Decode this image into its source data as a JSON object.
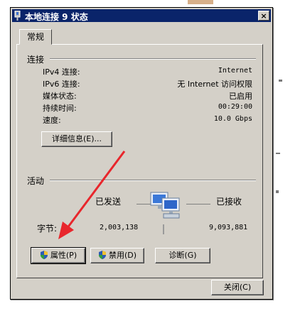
{
  "window": {
    "title": "本地连接 9 状态",
    "close_glyph": "×"
  },
  "tabs": [
    {
      "label": "常规"
    }
  ],
  "connection": {
    "section_label": "连接",
    "rows": [
      {
        "label": "IPv4 连接:",
        "value": "Internet"
      },
      {
        "label": "IPv6 连接:",
        "value": "无 Internet 访问权限"
      },
      {
        "label": "媒体状态:",
        "value": "已启用"
      },
      {
        "label": "持续时间:",
        "value": "00:29:00"
      },
      {
        "label": "速度:",
        "value": "10.0 Gbps"
      }
    ],
    "details_button": "详细信息(E)..."
  },
  "activity": {
    "section_label": "活动",
    "sent_label": "已发送",
    "received_label": "已接收",
    "bytes_label": "字节:",
    "bytes_sent": "2,003,138",
    "bytes_received": "9,093,881"
  },
  "buttons": {
    "properties": "属性(P)",
    "disable": "禁用(D)",
    "diagnose": "诊断(G)",
    "close": "关闭(C)"
  },
  "icons": {
    "title": "network-adapter-icon",
    "shield": "uac-shield-icon",
    "network": "network-computers-icon"
  },
  "colors": {
    "titlebar": "#0a246a",
    "dialog_face": "#d4d0c8",
    "annotation_arrow": "#e8262c"
  }
}
